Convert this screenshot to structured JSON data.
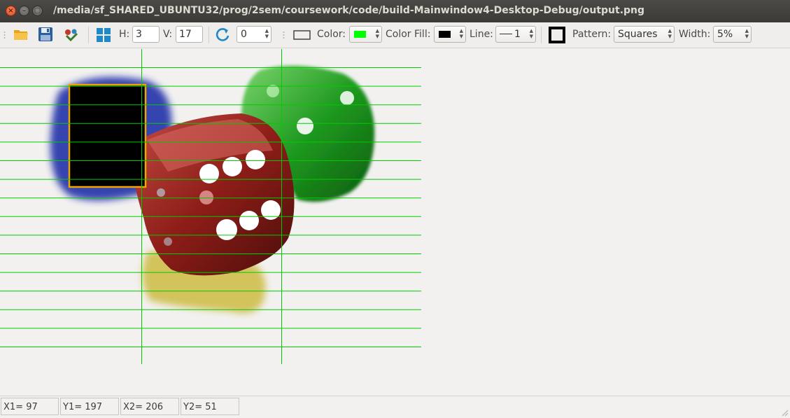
{
  "window": {
    "title": "/media/sf_SHARED_UBUNTU32/prog/2sem/coursework/code/build-Mainwindow4-Desktop-Debug/output.png",
    "close_glyph": "×",
    "min_glyph": "–",
    "max_glyph": "□"
  },
  "toolbar": {
    "h_label": "H:",
    "h_value": "3",
    "v_label": "V:",
    "v_value": "17",
    "rotate_value": "0",
    "color_label": "Color:",
    "color_value": "#00ff00",
    "color_fill_label": "Color Fill:",
    "color_fill_value": "#000000",
    "line_label": "Line:",
    "line_value": "1",
    "pattern_label": "Pattern:",
    "pattern_value": "Squares",
    "width_label": "Width:",
    "width_value": "5%"
  },
  "status": {
    "x1": "X1= 97",
    "y1": "Y1= 197",
    "x2": "X2= 206",
    "y2": "Y2= 51"
  },
  "colors": {
    "grid": "#00cc00",
    "selection_border": "#f0a500",
    "selection_fill": "#000000",
    "title_bg": "#3c3b37",
    "accent_blue": "#1e88c9"
  }
}
